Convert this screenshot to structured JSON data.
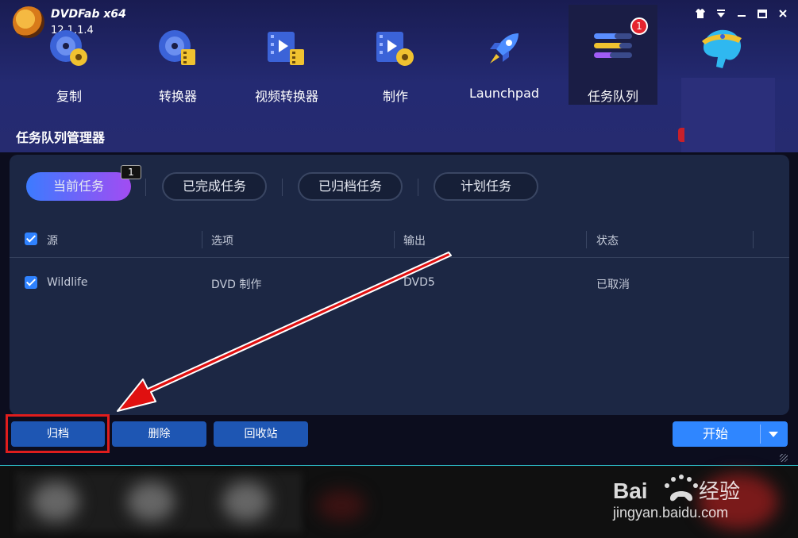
{
  "app": {
    "brand": "DVDFab x64",
    "version": "12.1.1.4"
  },
  "modules": [
    {
      "label": "复制",
      "icon": "disc-copy-icon"
    },
    {
      "label": "转换器",
      "icon": "disc-convert-icon"
    },
    {
      "label": "视频转换器",
      "icon": "video-convert-icon"
    },
    {
      "label": "制作",
      "icon": "disc-create-icon"
    },
    {
      "label": "Launchpad",
      "icon": "rocket-icon"
    },
    {
      "label": "任务队列",
      "icon": "task-queue-icon",
      "badge": "1",
      "active": true
    }
  ],
  "window_controls": [
    "skin-icon",
    "menu-icon",
    "minimize-icon",
    "maximize-icon",
    "close-icon"
  ],
  "page_title": "任务队列管理器",
  "tabs": [
    {
      "label": "当前任务",
      "count": "1",
      "active": true
    },
    {
      "label": "已完成任务"
    },
    {
      "label": "已归档任务"
    },
    {
      "label": "计划任务"
    }
  ],
  "table": {
    "columns": [
      "源",
      "选项",
      "输出",
      "状态"
    ],
    "rows": [
      {
        "checked": true,
        "source": "Wildlife",
        "option": "DVD 制作",
        "output": "DVD5",
        "status": "已取消"
      }
    ]
  },
  "actions": {
    "archive": "归档",
    "delete": "删除",
    "recycle": "回收站",
    "start": "开始"
  },
  "watermark": {
    "brand": "Bai",
    "brand_cn": "经验",
    "url": "jingyan.baidu.com"
  },
  "colors": {
    "accent": "#2f86ff",
    "highlight": "#e01d1d",
    "tab_gradient_start": "#3c7bff",
    "tab_gradient_end": "#a24cf2"
  }
}
